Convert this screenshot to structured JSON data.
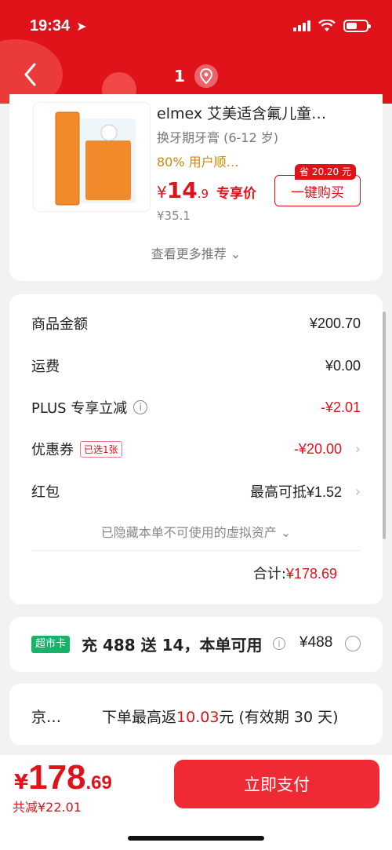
{
  "status_bar": {
    "time": "19:34"
  },
  "nav": {
    "count": "1"
  },
  "product": {
    "title": "elmex 艾美适含氟儿童…",
    "subtitle": "换牙期牙膏 (6-12 岁)",
    "tag": "80% 用户顺…",
    "price_symbol": "¥",
    "price_int": "14",
    "price_dec": ".9",
    "price_label": "专享价",
    "original_price": "¥35.1",
    "save_tag": "省 20.20 元",
    "buy_button": "一键购买",
    "more_recommend": "查看更多推荐"
  },
  "summary": {
    "rows": [
      {
        "label": "商品金额",
        "value": "¥200.70"
      },
      {
        "label": "运费",
        "value": "¥0.00"
      },
      {
        "label": "PLUS 专享立减",
        "value": "-¥2.01"
      },
      {
        "label": "优惠券",
        "chip": "已选1张",
        "value": "-¥20.00"
      },
      {
        "label": "红包",
        "value": "最高可抵¥1.52"
      }
    ],
    "hidden_assets": "已隐藏本单不可使用的虚拟资产",
    "total_label": "合计:",
    "total_value": "¥178.69"
  },
  "supermarket_card": {
    "tag": "超市卡",
    "text": "充 488 送 14，本单可用",
    "price": "¥488"
  },
  "rebate": {
    "left": "京…",
    "prefix": "下单最高返",
    "amount": "10.03",
    "suffix": "元 (有效期 30 天)"
  },
  "footer": {
    "price_symbol": "¥",
    "price_int": "178",
    "price_dec": ".69",
    "saved": "共减¥22.01",
    "pay_button": "立即支付"
  },
  "colors": {
    "brand_red": "#e0121a",
    "green_tag": "#18b36b",
    "tag_orange": "#d4870a"
  }
}
